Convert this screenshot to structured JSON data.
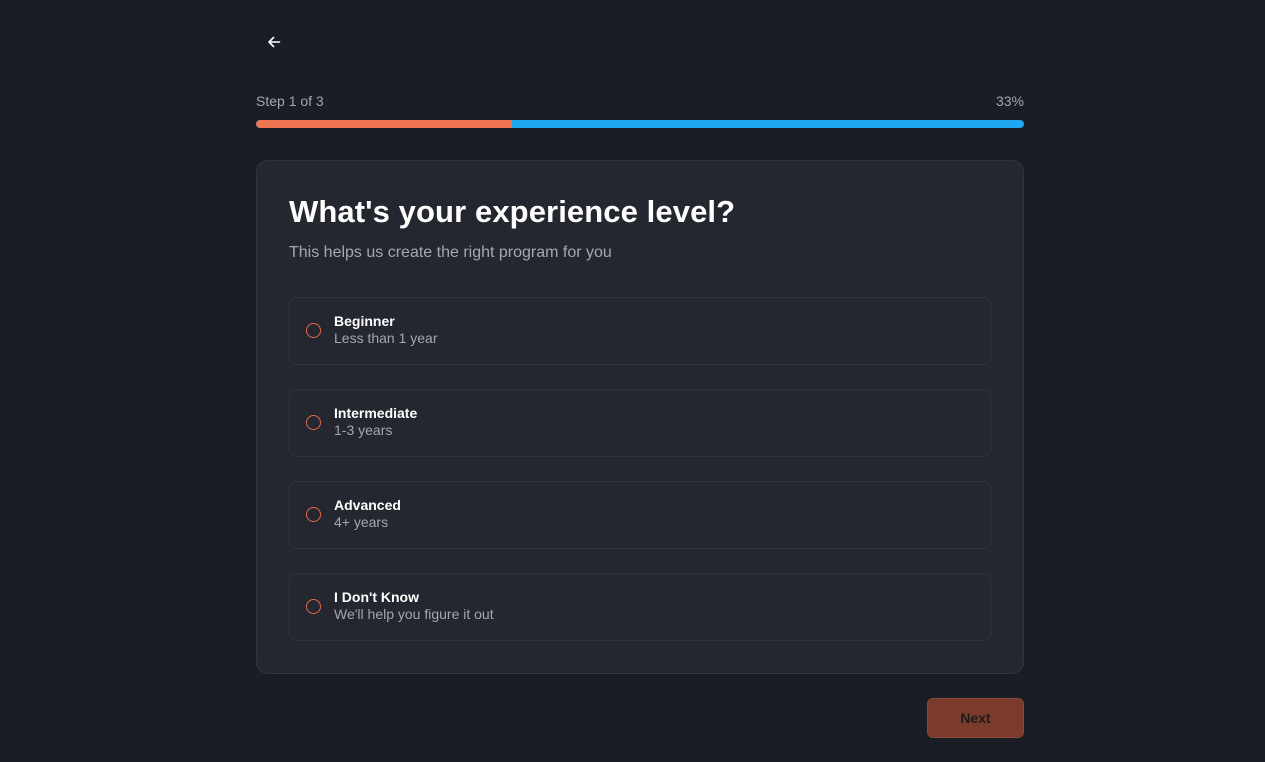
{
  "nav": {
    "back_icon": "arrow-left-icon"
  },
  "progress": {
    "step_label": "Step 1 of 3",
    "percent_label": "33%",
    "percent": 33.3,
    "fill_color": "#f07553",
    "track_color": "#1fa8f0"
  },
  "question": {
    "title": "What's your experience level?",
    "subtitle": "This helps us create the right program for you"
  },
  "options": [
    {
      "label": "Beginner",
      "description": "Less than 1 year"
    },
    {
      "label": "Intermediate",
      "description": "1-3 years"
    },
    {
      "label": "Advanced",
      "description": "4+ years"
    },
    {
      "label": "I Don't Know",
      "description": "We'll help you figure it out"
    }
  ],
  "footer": {
    "next_label": "Next"
  },
  "colors": {
    "background": "#1b1d24",
    "card": "#242730",
    "accent": "#e36a4c",
    "next_button": "#7a3b2c"
  }
}
